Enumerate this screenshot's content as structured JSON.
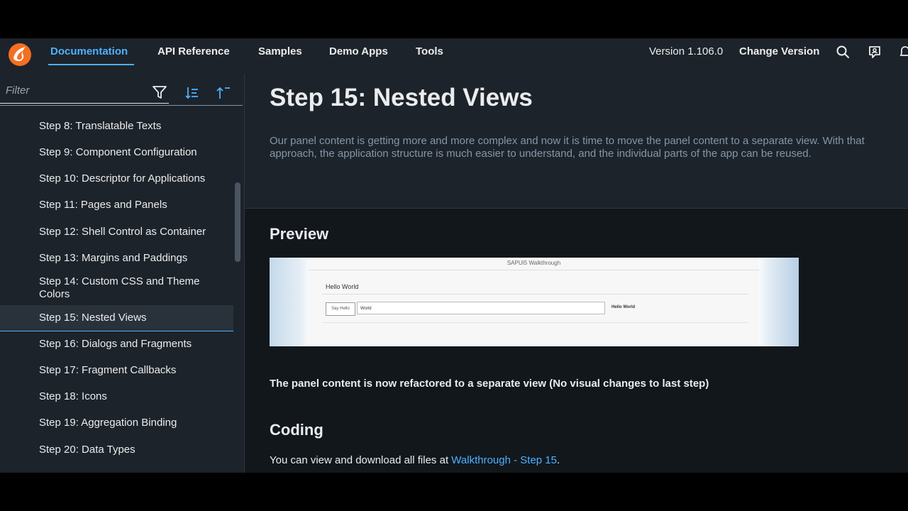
{
  "nav": {
    "items": [
      {
        "label": "Documentation"
      },
      {
        "label": "API Reference"
      },
      {
        "label": "Samples"
      },
      {
        "label": "Demo Apps"
      },
      {
        "label": "Tools"
      }
    ],
    "version": "Version 1.106.0",
    "change_version": "Change Version"
  },
  "sidebar": {
    "filter_placeholder": "Filter",
    "items": [
      {
        "label": "Step 8: Translatable Texts"
      },
      {
        "label": "Step 9: Component Configuration"
      },
      {
        "label": "Step 10: Descriptor for Applications"
      },
      {
        "label": "Step 11: Pages and Panels"
      },
      {
        "label": "Step 12: Shell Control as Container"
      },
      {
        "label": "Step 13: Margins and Paddings"
      },
      {
        "label": "Step 14: Custom CSS and Theme Colors"
      },
      {
        "label": "Step 15: Nested Views"
      },
      {
        "label": "Step 16: Dialogs and Fragments"
      },
      {
        "label": "Step 17: Fragment Callbacks"
      },
      {
        "label": "Step 18: Icons"
      },
      {
        "label": "Step 19: Aggregation Binding"
      },
      {
        "label": "Step 20: Data Types"
      }
    ]
  },
  "main": {
    "title": "Step 15: Nested Views",
    "intro": "Our panel content is getting more and more complex and now it is time to move the panel content to a separate view. With that approach, the application structure is much easier to understand, and the individual parts of the app can be reused.",
    "preview_heading": "Preview",
    "preview": {
      "app_title": "SAPUI5 Walkthrough",
      "panel_title": "Hello World",
      "button": "Say Hello",
      "input_value": "World",
      "output": "Hello World"
    },
    "caption": "The panel content is now refactored to a separate view (No visual changes to last step)",
    "coding_heading": "Coding",
    "coding_text": "You can view and download all files at ",
    "coding_link": "Walkthrough - Step 15",
    "coding_end": "."
  },
  "colors": {
    "accent": "#4db1ff",
    "background": "#1d232a",
    "content_background": "#12171c"
  }
}
